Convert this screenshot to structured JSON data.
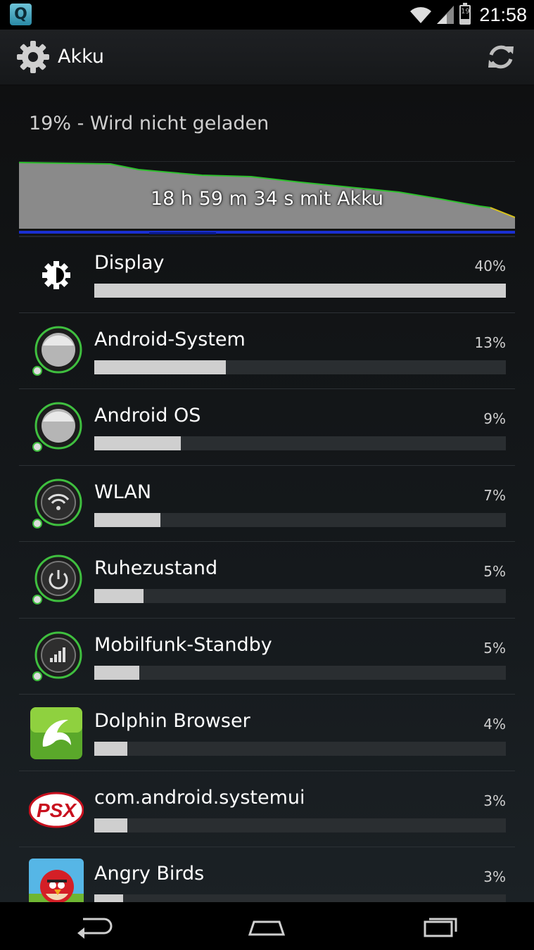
{
  "status_bar": {
    "notification_icon": "Q",
    "battery_level_text": "19",
    "time": "21:58",
    "icons": [
      "wifi-icon",
      "signal-icon",
      "battery-icon"
    ]
  },
  "action_bar": {
    "title": "Akku",
    "icons": [
      "settings-gear-icon",
      "refresh-icon"
    ]
  },
  "battery": {
    "status": "19% - Wird nicht geladen",
    "graph_label": "18 h 59 m 34 s mit Akku"
  },
  "usage": [
    {
      "name": "Display",
      "percent_text": "40%",
      "fraction": 1.0,
      "icon": "brightness-icon"
    },
    {
      "name": "Android-System",
      "percent_text": "13%",
      "fraction": 0.32,
      "icon": "android-system-icon"
    },
    {
      "name": "Android OS",
      "percent_text": "9%",
      "fraction": 0.21,
      "icon": "android-os-icon"
    },
    {
      "name": "WLAN",
      "percent_text": "7%",
      "fraction": 0.16,
      "icon": "wifi-icon"
    },
    {
      "name": "Ruhezustand",
      "percent_text": "5%",
      "fraction": 0.12,
      "icon": "power-icon"
    },
    {
      "name": "Mobilfunk-Standby",
      "percent_text": "5%",
      "fraction": 0.11,
      "icon": "cell-signal-icon"
    },
    {
      "name": "Dolphin Browser",
      "percent_text": "4%",
      "fraction": 0.08,
      "icon": "dolphin-browser-icon"
    },
    {
      "name": "com.android.systemui",
      "percent_text": "3%",
      "fraction": 0.08,
      "icon": "psx-icon"
    },
    {
      "name": "Angry Birds",
      "percent_text": "3%",
      "fraction": 0.07,
      "icon": "angry-birds-icon"
    }
  ],
  "psx_logo": "PSX",
  "navigation": [
    "back-icon",
    "home-icon",
    "recent-apps-icon"
  ],
  "colors": {
    "graph_line": "#2ec02e",
    "graph_fill": "#8a8a8a",
    "graph_baseline": "#1a2fd0",
    "bar_fill": "#cfcfcf",
    "bar_track": "#2a2e31"
  }
}
